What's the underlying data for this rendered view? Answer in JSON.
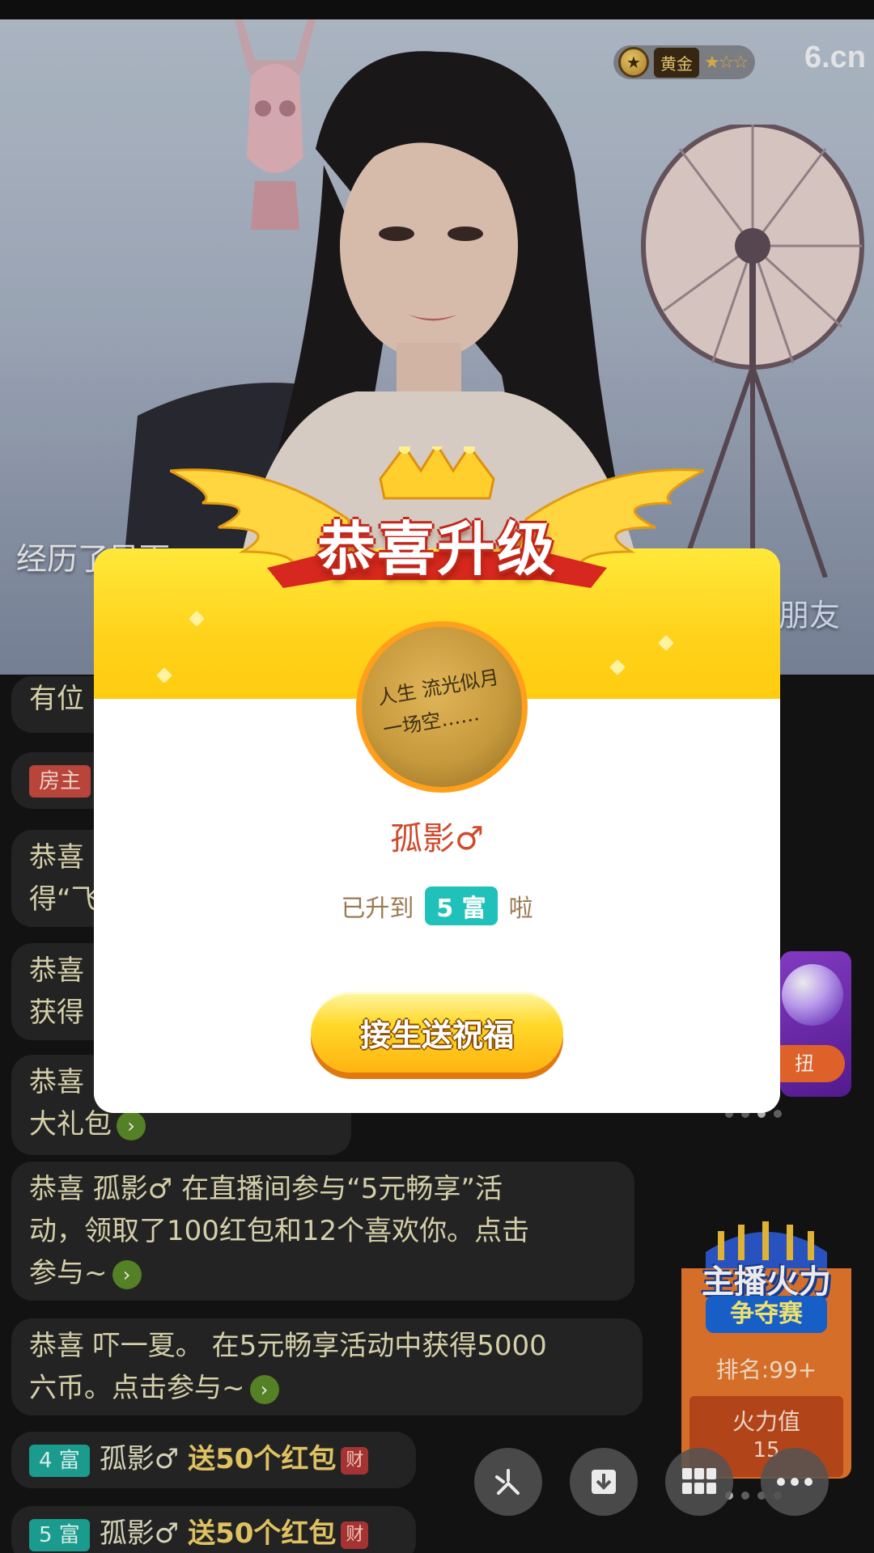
{
  "stream": {
    "level_label": "黄金",
    "level_stars": "★☆☆",
    "brand": "6.cn",
    "caption_left": "经历了风雨",
    "caption_right": "朋友"
  },
  "chat": [
    {
      "text": "有位"
    },
    {
      "tag": "房主"
    },
    {
      "lines": [
        "恭喜",
        "得“飞"
      ]
    },
    {
      "lines": [
        "恭喜",
        "获得"
      ]
    },
    {
      "lines": [
        "恭喜",
        "大礼包"
      ]
    },
    {
      "lines": [
        "恭喜 孤影♂ 在直播间参与“5元畅享”活",
        "动，领取了100红包和12个喜欢你。点击",
        "参与~"
      ]
    },
    {
      "lines": [
        "恭喜 吓一夏。 在5元畅享活动中获得5000",
        "六币。点击参与~"
      ]
    },
    {
      "tag": "4 富",
      "name": "孤影♂",
      "gift": "送50个红包",
      "icon": "财"
    },
    {
      "tag": "5 富",
      "name": "孤影♂",
      "gift": "送50个红包",
      "icon": "财"
    }
  ],
  "side_card": {
    "button": "扭"
  },
  "fire": {
    "title_line1": "主播火力",
    "title_line2": "争夺赛",
    "rank_label": "排名:",
    "rank_value": "99+",
    "heat_label": "火力值",
    "heat_value": "15"
  },
  "modal": {
    "title": "恭喜升级",
    "avatar_writing": "人生 流光似月 一场空……",
    "username": "孤影♂",
    "upgrade_prefix": "已升到",
    "rich_level": "5 富",
    "upgrade_suffix": "啦",
    "cta_label": "接生送祝福"
  },
  "colors": {
    "modal_header": "#ffd21a",
    "rich_badge": "#1fc1ba",
    "username": "#d04a2d"
  },
  "icons": [
    "star-coin-icon",
    "share-icon",
    "download-icon",
    "grid-icon",
    "more-icon",
    "chevron-right-icon"
  ]
}
